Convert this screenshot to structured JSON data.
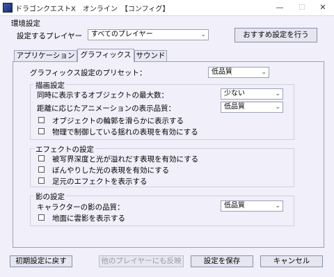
{
  "window": {
    "title": "ドラゴンクエストX　オンライン　【コンフィグ】",
    "minimize": "—",
    "maximize": "☐",
    "close": "✕"
  },
  "env": {
    "section_label": "環境設定",
    "player_label": "設定するプレイヤー",
    "player_value": "すべてのプレイヤー",
    "recommend_button": "おすすめ設定を行う"
  },
  "tabs": [
    "アプリケーション",
    "グラフィックス",
    "サウンド"
  ],
  "graphics": {
    "preset_label": "グラフィックス設定のプリセット：",
    "preset_value": "低品質",
    "drawing": {
      "title": "描画設定",
      "max_objects_label": "同時に表示するオブジェクトの最大数：",
      "max_objects_value": "少ない",
      "anim_quality_label": "距離に応じたアニメーションの表示品質：",
      "anim_quality_value": "低品質",
      "smooth_outline": "オブジェクトの輪郭を滑らかに表示する",
      "physics_sway": "物理で制御している揺れの表現を有効にする"
    },
    "effects": {
      "title": "エフェクトの設定",
      "dof": "被写界深度と光が溢れだす表現を有効にする",
      "soft_light": "ぼんやりした光の表現を有効にする",
      "footstep": "足元のエフェクトを表示する"
    },
    "shadow": {
      "title": "影の設定",
      "char_shadow_label": "キャラクターの影の品質：",
      "char_shadow_value": "低品質",
      "cloud_shadow": "地面に雲影を表示する"
    }
  },
  "footer": {
    "reset": "初期設定に戻す",
    "apply_others": "他のプレイヤーにも反映",
    "save": "設定を保存",
    "cancel": "キャンセル"
  },
  "icons": {
    "dropdown": "chevron-down-icon",
    "checkbox": "checkbox-unchecked"
  }
}
